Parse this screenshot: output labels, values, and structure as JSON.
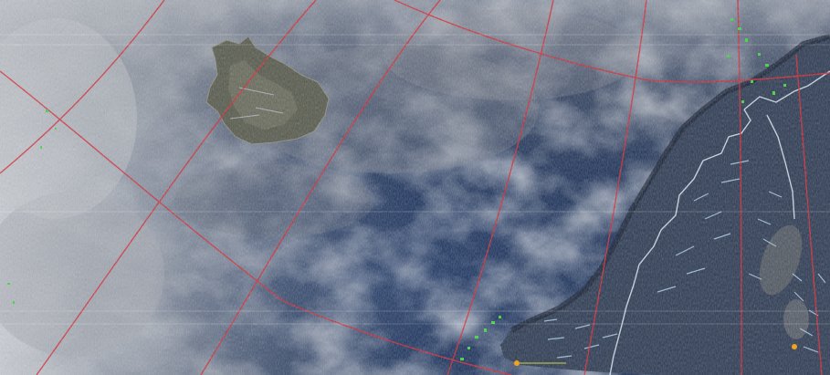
{
  "image": {
    "kind": "weather satellite image (NOAA-style false colour) with graticule overlay",
    "colors": {
      "ocean_deep": "#14284f",
      "ocean_mid": "#233a66",
      "cloud_light": "#c9ccd2",
      "cloud_mid": "#8d939c",
      "land_iceland": "#5b5e4e",
      "land_scandinavia": "#2c3a52",
      "graticule": "#d8252f",
      "coastline": "#d6e6f2",
      "lakes_rivers": "#a9c9e6",
      "precip_green": "#3cd63c",
      "marker_orange": "#f2a21b"
    },
    "features": [
      "clouds",
      "ocean",
      "iceland",
      "scandinavia",
      "graticule-grid",
      "coastline-overlay",
      "precipitation-green",
      "scanline-noise",
      "city-markers"
    ]
  }
}
